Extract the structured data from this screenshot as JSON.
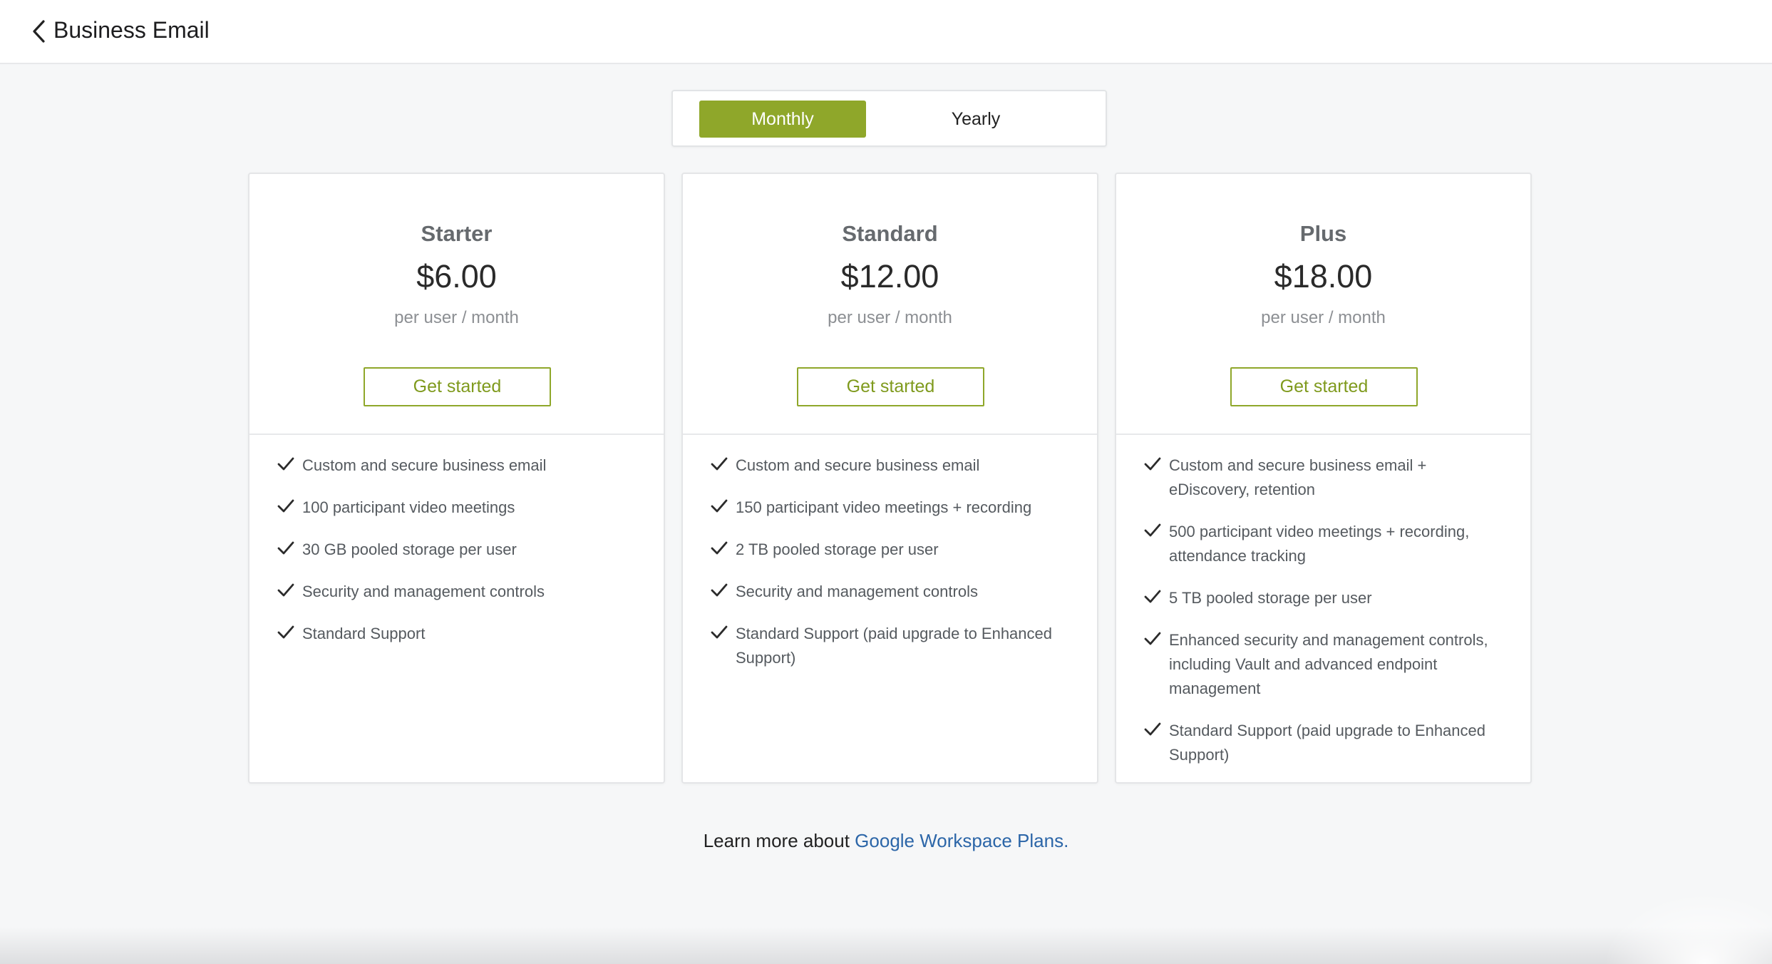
{
  "header": {
    "title": "Business Email",
    "back_icon": "chevron-left-icon"
  },
  "billing_toggle": {
    "options": [
      "Monthly",
      "Yearly"
    ],
    "selected": "Monthly",
    "accent_color": "#8fa72a"
  },
  "plans": [
    {
      "name": "Starter",
      "price": "$6.00",
      "period": "per user / month",
      "cta": "Get started",
      "features": [
        "Custom and secure business email",
        "100 participant video meetings",
        "30 GB pooled storage per user",
        "Security and management controls",
        "Standard Support"
      ]
    },
    {
      "name": "Standard",
      "price": "$12.00",
      "period": "per user / month",
      "cta": "Get started",
      "features": [
        "Custom and secure business email",
        "150 participant video meetings + recording",
        "2 TB pooled storage per user",
        "Security and management controls",
        "Standard Support (paid upgrade to Enhanced Support)"
      ]
    },
    {
      "name": "Plus",
      "price": "$18.00",
      "period": "per user / month",
      "cta": "Get started",
      "features": [
        "Custom and secure business email + eDiscovery, retention",
        "500 participant video meetings + recording, attendance tracking",
        "5 TB pooled storage per user",
        "Enhanced security and management controls, including Vault and advanced endpoint management",
        "Standard Support (paid upgrade to Enhanced Support)"
      ]
    }
  ],
  "footer": {
    "learn_prefix": "Learn more about ",
    "learn_link": "Google Workspace Plans.",
    "link_color": "#2c66a8"
  }
}
